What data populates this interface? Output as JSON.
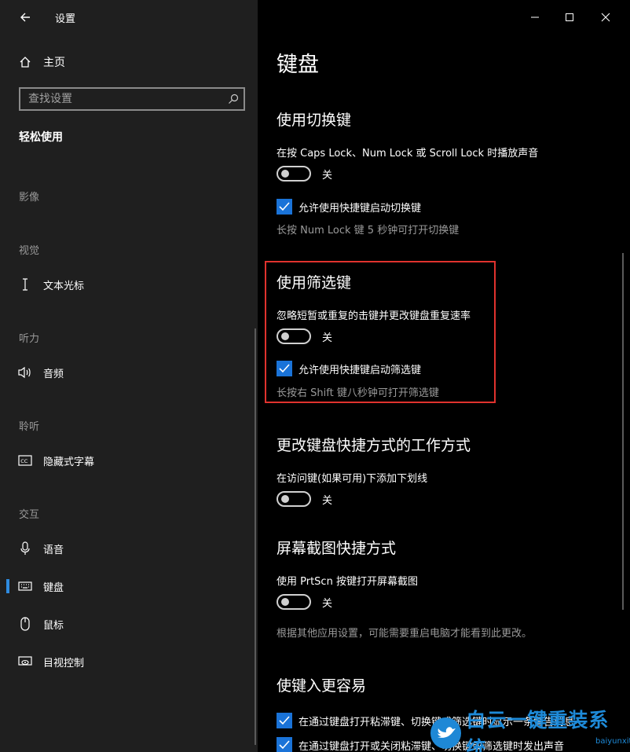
{
  "window": {
    "app_title": "设置"
  },
  "sidebar": {
    "home_label": "主页",
    "search_placeholder": "查找设置",
    "section_title": "轻松使用",
    "categories": {
      "vision_images": "影像",
      "vision": "视觉",
      "hearing": "听力",
      "hearing_listen": "聆听",
      "interaction": "交互"
    },
    "items": {
      "text_cursor": "文本光标",
      "audio": "音频",
      "captions": "隐藏式字幕",
      "speech": "语音",
      "keyboard": "键盘",
      "mouse": "鼠标",
      "eye_control": "目视控制"
    }
  },
  "main": {
    "page_title": "键盘",
    "toggle_keys": {
      "title": "使用切换键",
      "desc": "在按 Caps Lock、Num Lock 或 Scroll Lock 时播放声音",
      "state": "关",
      "checkbox_label": "允许使用快捷键启动切换键",
      "hint": "长按 Num Lock 键 5 秒钟可打开切换键"
    },
    "filter_keys": {
      "title": "使用筛选键",
      "desc": "忽略短暂或重复的击键并更改键盘重复速率",
      "state": "关",
      "checkbox_label": "允许使用快捷键启动筛选键",
      "hint": "长按右 Shift 键八秒钟可打开筛选键"
    },
    "shortcuts": {
      "title": "更改键盘快捷方式的工作方式",
      "desc": "在访问键(如果可用)下添加下划线",
      "state": "关"
    },
    "print_screen": {
      "title": "屏幕截图快捷方式",
      "desc": "使用 PrtScn 按键打开屏幕截图",
      "state": "关",
      "hint": "根据其他应用设置，可能需要重启电脑才能看到此更改。"
    },
    "easier_typing": {
      "title": "使键入更容易",
      "check1": "在通过键盘打开粘滞键、切换键或筛选键时显示一条警告消息",
      "check2": "在通过键盘打开或关闭粘滞键、切换键或筛选键时发出声音"
    }
  },
  "watermark": {
    "text": "白云一键重装系统",
    "url": "baiyunxitong.com"
  },
  "colors": {
    "accent": "#1a73d8",
    "highlight": "#e0322e"
  }
}
